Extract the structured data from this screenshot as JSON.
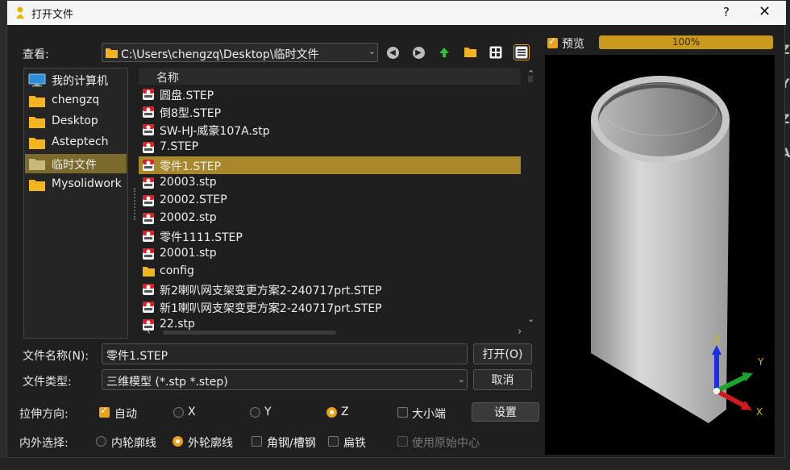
{
  "window": {
    "title": "打开文件",
    "help": "?",
    "close": "✕"
  },
  "background_right_chars": [
    "Z",
    "Y",
    "Z",
    "A"
  ],
  "lookin": {
    "label": "查看:",
    "path": "C:\\Users\\chengzq\\Desktop\\临时文件"
  },
  "toolbar_icons": [
    "back-icon",
    "forward-icon",
    "up-icon",
    "new-folder-icon",
    "list-view-icon",
    "detail-view-icon"
  ],
  "sidebar": {
    "items": [
      {
        "label": "我的计算机",
        "icon": "computer-icon"
      },
      {
        "label": "chengzq",
        "icon": "folder-icon"
      },
      {
        "label": "Desktop",
        "icon": "folder-icon"
      },
      {
        "label": "Asteptech",
        "icon": "folder-icon"
      },
      {
        "label": "临时文件",
        "icon": "folder-icon",
        "selected": true
      },
      {
        "label": "Mysolidwork",
        "icon": "folder-icon"
      }
    ]
  },
  "filelist": {
    "header": "名称",
    "files": [
      {
        "name": "圆盘.STEP",
        "type": "step"
      },
      {
        "name": "倒8型.STEP",
        "type": "step"
      },
      {
        "name": "SW-HJ-威豪107A.stp",
        "type": "step"
      },
      {
        "name": "7.STEP",
        "type": "step"
      },
      {
        "name": "零件1.STEP",
        "type": "step",
        "selected": true
      },
      {
        "name": "20003.stp",
        "type": "step"
      },
      {
        "name": "20002.STEP",
        "type": "step"
      },
      {
        "name": "20002.stp",
        "type": "step"
      },
      {
        "name": "零件1111.STEP",
        "type": "step"
      },
      {
        "name": "20001.stp",
        "type": "step"
      },
      {
        "name": "config",
        "type": "folder"
      },
      {
        "name": "新2喇叭网支架变更方案2-240717prt.STEP",
        "type": "step"
      },
      {
        "name": "新1喇叭网支架变更方案2-240717prt.STEP",
        "type": "step"
      },
      {
        "name": "22.stp",
        "type": "step"
      }
    ]
  },
  "filename": {
    "label": "文件名称(N):",
    "value": "零件1.STEP"
  },
  "filetype": {
    "label": "文件类型:",
    "value": "三维模型 (*.stp *.step)"
  },
  "buttons": {
    "open": "打开(O)",
    "cancel": "取消",
    "settings": "设置"
  },
  "stretch": {
    "label": "拉伸方向:",
    "auto": "自动",
    "x": "X",
    "y": "Y",
    "z": "Z",
    "endian": "大小端"
  },
  "inout": {
    "label": "内外选择:",
    "inner": "内轮廓线",
    "outer": "外轮廓线",
    "angle_steel": "角钢/槽钢",
    "flat_iron": "扁铁",
    "origin_center": "使用原始中心"
  },
  "preview": {
    "label": "预览",
    "checked": true,
    "progress": 1.0,
    "progress_text": "100%"
  },
  "axes": {
    "z": "Z",
    "y": "Y",
    "x": "X"
  },
  "colors": {
    "accent": "#e9a21a",
    "selection": "#a8882a",
    "progress": "#c99a1e",
    "axis_z": "#1e2ee8",
    "axis_y": "#1aa62a",
    "axis_x": "#d21a1a"
  }
}
